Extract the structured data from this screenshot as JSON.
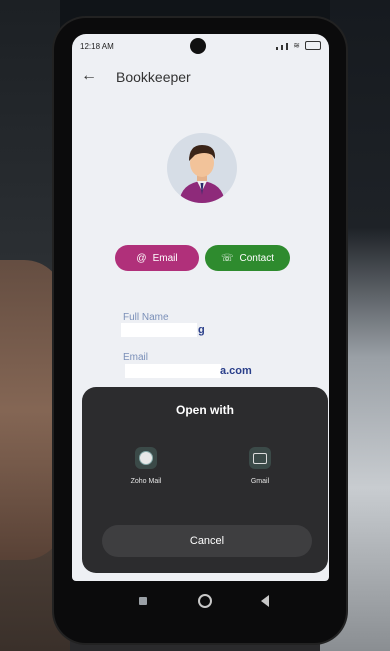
{
  "status": {
    "time": "12:18 AM"
  },
  "appbar": {
    "title": "Bookkeeper"
  },
  "actions": {
    "email_label": "Email",
    "contact_label": "Contact"
  },
  "fields": {
    "full_name_label": "Full Name",
    "full_name_value_visible": "g",
    "email_label": "Email",
    "email_value_visible": "a.com"
  },
  "sheet": {
    "title": "Open with",
    "apps": [
      {
        "label": "Zoho Mail",
        "icon": "zoho-mail-icon"
      },
      {
        "label": "Gmail",
        "icon": "gmail-icon"
      }
    ],
    "cancel_label": "Cancel"
  },
  "colors": {
    "email_button": "#b0307a",
    "contact_button": "#2e8b2e",
    "sheet_bg": "#2c2c2e"
  }
}
